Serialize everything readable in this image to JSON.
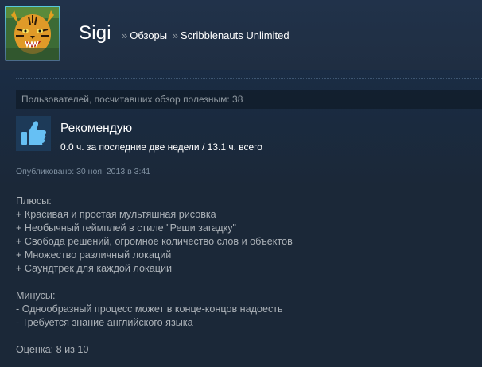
{
  "header": {
    "persona_name": "Sigi",
    "breadcrumb_sep": "»",
    "breadcrumb_reviews": "Обзоры",
    "breadcrumb_game": "Scribblenauts Unlimited"
  },
  "review": {
    "helpful_text": "Пользователей, посчитавших обзор полезным: 38",
    "verdict": "Рекомендую",
    "hours": "0.0 ч. за последние две недели / 13.1 ч. всего",
    "posted": "Опубликовано: 30 ноя. 2013 в 3:41",
    "body": {
      "pros_title": "Плюсы:",
      "pros": [
        "+ Красивая и простая мультяшная рисовка",
        "+ Необычный геймплей в стиле \"Реши загадку\"",
        "+ Свобода решений, огромное количество слов и объектов",
        "+ Множество различный локаций",
        "+ Саундтрек для каждой локации"
      ],
      "cons_title": "Минусы:",
      "cons": [
        "- Однообразный процесс может в конце-концов надоесть",
        "- Требуется знание английского языка"
      ],
      "score": "Оценка: 8 из 10"
    }
  },
  "colors": {
    "background": "#1b2838",
    "header_bg": "#21324a",
    "avatar_border": "#57cbde",
    "thumb_blue": "#66c0f4"
  },
  "icons": {
    "avatar": "tiger-avatar",
    "thumb": "thumbs-up-icon"
  }
}
